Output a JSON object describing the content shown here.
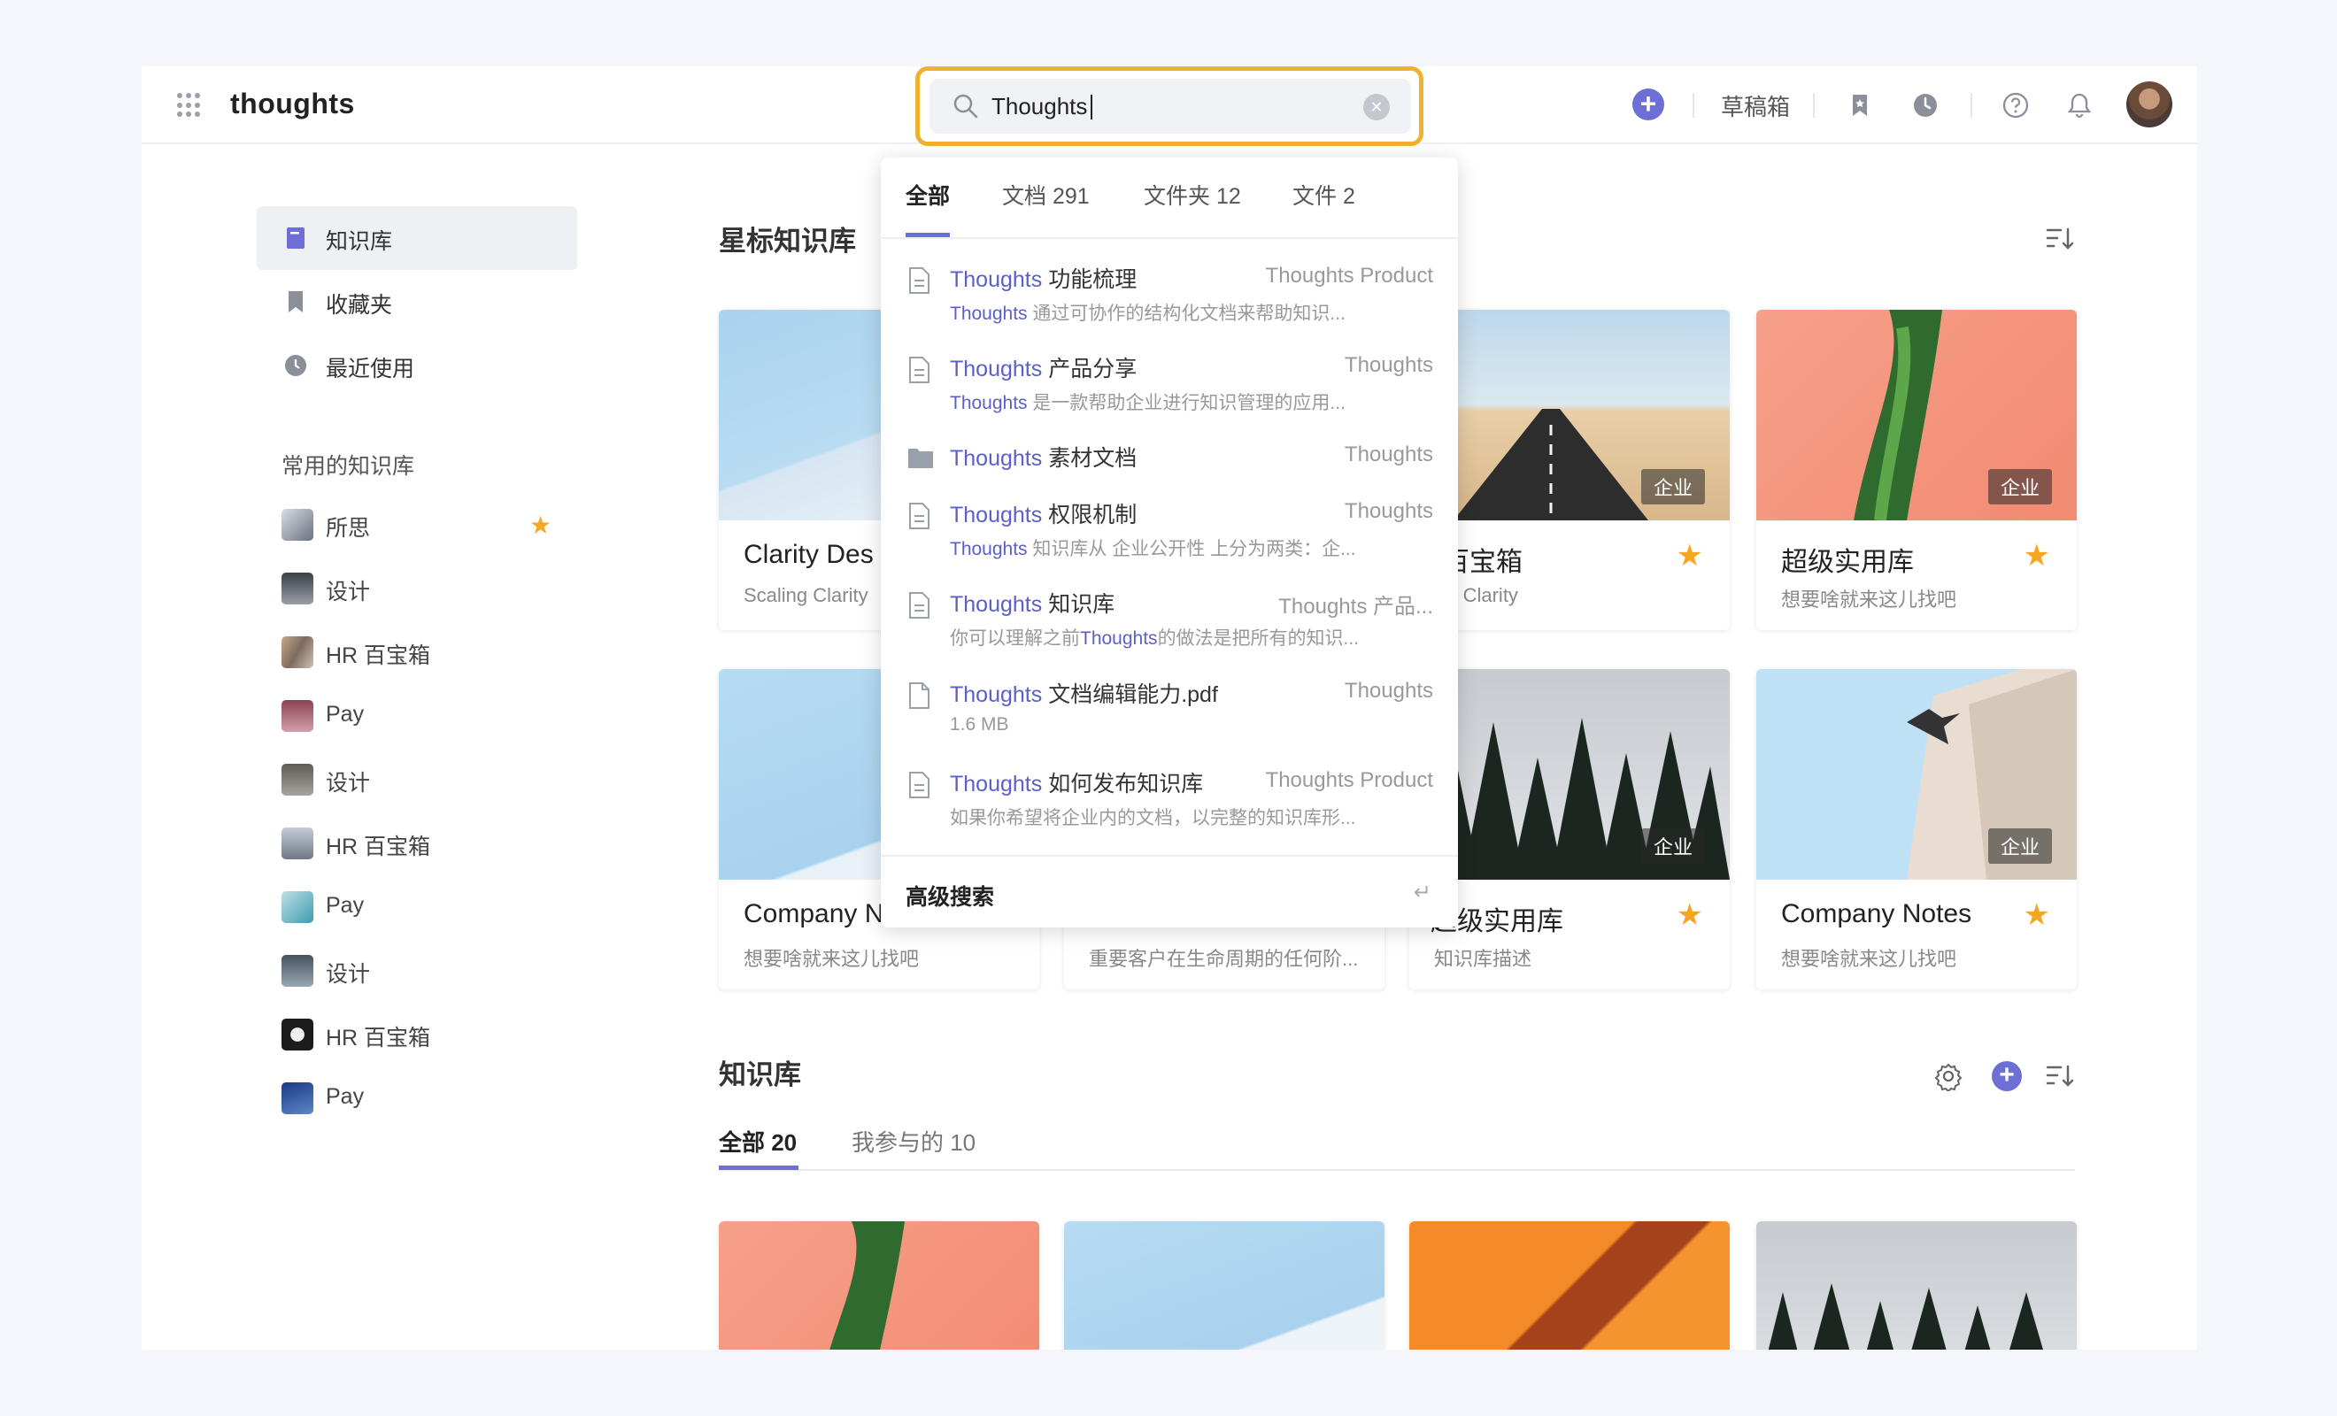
{
  "header": {
    "app_name": "thoughts",
    "search_value": "Thoughts",
    "drafts_label": "草稿箱"
  },
  "sidebar": {
    "items": [
      {
        "label": "知识库",
        "icon": "book-icon"
      },
      {
        "label": "收藏夹",
        "icon": "bookmark-icon"
      },
      {
        "label": "最近使用",
        "icon": "clock-icon"
      }
    ],
    "section_title": "常用的知识库",
    "knowledge_bases": [
      {
        "label": "所思",
        "starred": true
      },
      {
        "label": "设计"
      },
      {
        "label": "HR 百宝箱"
      },
      {
        "label": "Pay"
      },
      {
        "label": "设计"
      },
      {
        "label": "HR 百宝箱"
      },
      {
        "label": "Pay"
      },
      {
        "label": "设计"
      },
      {
        "label": "HR 百宝箱"
      },
      {
        "label": "Pay"
      }
    ]
  },
  "starred": {
    "title": "星标知识库",
    "cards": [
      {
        "title": "Clarity Des",
        "desc": "Scaling Clarity"
      },
      {
        "title": "R 百宝箱",
        "desc": "aling Clarity",
        "badge": "企业"
      },
      {
        "title": "超级实用库",
        "desc": "想要啥就来这儿找吧",
        "badge": "企业"
      },
      {
        "title": "Company N",
        "desc": "想要啥就来这儿找吧"
      },
      {
        "title": "",
        "desc": "重要客户在生命周期的任何阶..."
      },
      {
        "title": "超级实用库",
        "desc": "知识库描述",
        "badge": "企业"
      },
      {
        "title": "Company Notes",
        "desc": "想要啥就来这儿找吧",
        "badge": "企业"
      }
    ]
  },
  "library": {
    "title": "知识库",
    "tab_all": "全部 20",
    "tab_mine": "我参与的 10"
  },
  "dropdown": {
    "tabs": [
      "全部",
      "文档 291",
      "文件夹 12",
      "文件 2"
    ],
    "results": [
      {
        "hl": "Thoughts",
        "rest": " 功能梳理",
        "source": "Thoughts Product",
        "snip_hl": "Thoughts",
        "snip": " 通过可协作的结构化文档来帮助知识..."
      },
      {
        "hl": "Thoughts",
        "rest": " 产品分享",
        "source": "Thoughts",
        "snip_hl": "Thoughts",
        "snip": " 是一款帮助企业进行知识管理的应用..."
      },
      {
        "hl": "Thoughts",
        "rest": " 素材文档",
        "source": "Thoughts"
      },
      {
        "hl": "Thoughts",
        "rest": " 权限机制",
        "source": "Thoughts",
        "snip_hl": "Thoughts",
        "snip": " 知识库从 企业公开性 上分为两类：企..."
      },
      {
        "hl": "Thoughts",
        "rest": " 知识库",
        "source": "Thoughts 产品...",
        "snip_pre": "你可以理解之前",
        "snip_hl": "Thoughts",
        "snip": "的做法是把所有的知识..."
      },
      {
        "hl": "Thoughts",
        "rest": " 文档编辑能力.pdf",
        "source": "Thoughts",
        "snip": "1.6 MB"
      },
      {
        "hl": "Thoughts",
        "rest": " 如何发布知识库",
        "source": "Thoughts Product",
        "snip": "如果你希望将企业内的文档，以完整的知识库形..."
      }
    ],
    "advanced": "高级搜索",
    "enter_glyph": "↵"
  },
  "colors": {
    "accent": "#6e6fd6",
    "highlight": "#f0b030",
    "star": "#f5a623"
  }
}
